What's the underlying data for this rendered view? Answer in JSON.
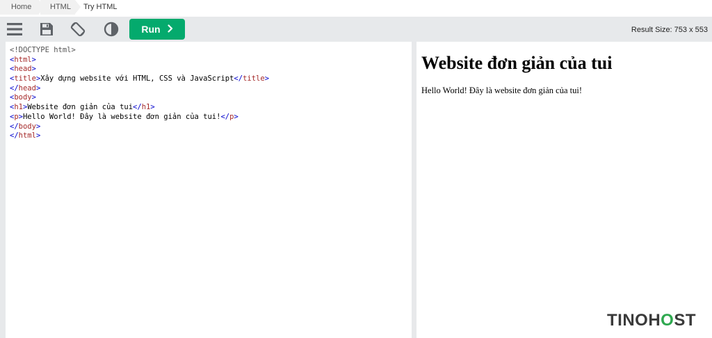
{
  "breadcrumb": {
    "items": [
      "Home",
      "HTML",
      "Try HTML"
    ]
  },
  "toolbar": {
    "icons": [
      "menu-icon",
      "save-icon",
      "rotate-icon",
      "contrast-icon"
    ],
    "run_label": "Run",
    "run_color": "#04aa6d",
    "result_size": "Result Size: 753 x 553"
  },
  "editor": {
    "lines": [
      {
        "parts": [
          {
            "t": "doctype",
            "v": "<!DOCTYPE html>"
          }
        ]
      },
      {
        "parts": [
          {
            "t": "br",
            "v": "<"
          },
          {
            "t": "tag",
            "v": "html"
          },
          {
            "t": "br",
            "v": ">"
          }
        ]
      },
      {
        "parts": [
          {
            "t": "br",
            "v": "<"
          },
          {
            "t": "tag",
            "v": "head"
          },
          {
            "t": "br",
            "v": ">"
          }
        ]
      },
      {
        "parts": [
          {
            "t": "br",
            "v": "<"
          },
          {
            "t": "tag",
            "v": "title"
          },
          {
            "t": "br",
            "v": ">"
          },
          {
            "t": "txt",
            "v": "Xây dựng website với HTML, CSS và JavaScript"
          },
          {
            "t": "br",
            "v": "</"
          },
          {
            "t": "tag",
            "v": "title"
          },
          {
            "t": "br",
            "v": ">"
          }
        ]
      },
      {
        "parts": [
          {
            "t": "br",
            "v": "</"
          },
          {
            "t": "tag",
            "v": "head"
          },
          {
            "t": "br",
            "v": ">"
          }
        ]
      },
      {
        "parts": [
          {
            "t": "br",
            "v": "<"
          },
          {
            "t": "tag",
            "v": "body"
          },
          {
            "t": "br",
            "v": ">"
          }
        ]
      },
      {
        "parts": [
          {
            "t": "br",
            "v": "<"
          },
          {
            "t": "tag",
            "v": "h1"
          },
          {
            "t": "br",
            "v": ">"
          },
          {
            "t": "txt",
            "v": "Website đơn giản của tui"
          },
          {
            "t": "br",
            "v": "</"
          },
          {
            "t": "tag",
            "v": "h1"
          },
          {
            "t": "br",
            "v": ">"
          }
        ]
      },
      {
        "parts": [
          {
            "t": "br",
            "v": "<"
          },
          {
            "t": "tag",
            "v": "p"
          },
          {
            "t": "br",
            "v": ">"
          },
          {
            "t": "txt",
            "v": "Hello World! Đây là website đơn giản của tui!"
          },
          {
            "t": "br",
            "v": "</"
          },
          {
            "t": "tag",
            "v": "p"
          },
          {
            "t": "br",
            "v": ">"
          }
        ]
      },
      {
        "parts": [
          {
            "t": "br",
            "v": "</"
          },
          {
            "t": "tag",
            "v": "body"
          },
          {
            "t": "br",
            "v": ">"
          }
        ]
      },
      {
        "parts": [
          {
            "t": "br",
            "v": "</"
          },
          {
            "t": "tag",
            "v": "html"
          },
          {
            "t": "br",
            "v": ">"
          }
        ]
      }
    ]
  },
  "result": {
    "heading": "Website đơn giản của tui",
    "paragraph": "Hello World! Đây là website đơn giản của tui!"
  },
  "watermark": {
    "part1": "TINO",
    "part2": "H",
    "part3": "O",
    "part4": "ST",
    "accent_color": "#2ea84f"
  }
}
